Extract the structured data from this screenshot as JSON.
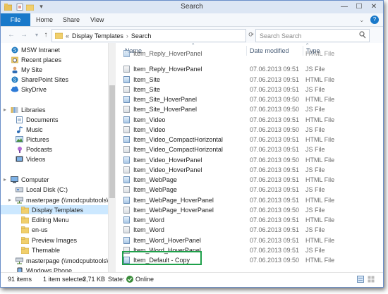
{
  "window": {
    "title": "Search"
  },
  "ribbon": {
    "tabs": [
      "File",
      "Home",
      "Share",
      "View"
    ]
  },
  "address": {
    "prefix": "«",
    "crumbs": [
      "Display Templates",
      "Search"
    ],
    "search_placeholder": "Search Search"
  },
  "nav": [
    {
      "label": "MSW Intranet",
      "icon": "sharepoint-icon"
    },
    {
      "label": "Recent places",
      "icon": "recent-icon"
    },
    {
      "label": "My Site",
      "icon": "user-icon"
    },
    {
      "label": "SharePoint Sites",
      "icon": "sharepoint-icon"
    },
    {
      "label": "SkyDrive",
      "icon": "cloud-icon"
    },
    {
      "label": "Libraries",
      "icon": "library-icon"
    },
    {
      "label": "Documents",
      "icon": "document-icon"
    },
    {
      "label": "Music",
      "icon": "music-icon"
    },
    {
      "label": "Pictures",
      "icon": "picture-icon"
    },
    {
      "label": "Podcasts",
      "icon": "podcast-icon"
    },
    {
      "label": "Videos",
      "icon": "video-icon"
    },
    {
      "label": "Computer",
      "icon": "computer-icon"
    },
    {
      "label": "Local Disk (C:)",
      "icon": "drive-icon"
    },
    {
      "label": "masterpage (\\\\modcpubtools\\D",
      "icon": "network-drive-icon"
    },
    {
      "label": "Display Templates",
      "icon": "folder-icon",
      "selected": true
    },
    {
      "label": "Editing Menu",
      "icon": "folder-icon"
    },
    {
      "label": "en-us",
      "icon": "folder-icon"
    },
    {
      "label": "Preview Images",
      "icon": "folder-icon"
    },
    {
      "label": "Themable",
      "icon": "folder-icon"
    },
    {
      "label": "masterpage (\\\\modcpubtools\\D",
      "icon": "network-drive-icon"
    },
    {
      "label": "Windows Phone",
      "icon": "phone-icon"
    }
  ],
  "columns": {
    "name": "Name",
    "date": "Date modified",
    "type": "Type"
  },
  "files": [
    {
      "name": "Item_Reply_HoverPanel",
      "date": "",
      "type": "HTML File"
    },
    {
      "name": "Item_Reply_HoverPanel",
      "date": "07.06.2013 09:51",
      "type": "JS File"
    },
    {
      "name": "Item_Site",
      "date": "07.06.2013 09:51",
      "type": "HTML File"
    },
    {
      "name": "Item_Site",
      "date": "07.06.2013 09:51",
      "type": "JS File"
    },
    {
      "name": "Item_Site_HoverPanel",
      "date": "07.06.2013 09:50",
      "type": "HTML File"
    },
    {
      "name": "Item_Site_HoverPanel",
      "date": "07.06.2013 09:50",
      "type": "JS File"
    },
    {
      "name": "Item_Video",
      "date": "07.06.2013 09:51",
      "type": "HTML File"
    },
    {
      "name": "Item_Video",
      "date": "07.06.2013 09:50",
      "type": "JS File"
    },
    {
      "name": "Item_Video_CompactHorizontal",
      "date": "07.06.2013 09:51",
      "type": "HTML File"
    },
    {
      "name": "Item_Video_CompactHorizontal",
      "date": "07.06.2013 09:51",
      "type": "JS File"
    },
    {
      "name": "Item_Video_HoverPanel",
      "date": "07.06.2013 09:50",
      "type": "HTML File"
    },
    {
      "name": "Item_Video_HoverPanel",
      "date": "07.06.2013 09:51",
      "type": "JS File"
    },
    {
      "name": "Item_WebPage",
      "date": "07.06.2013 09:51",
      "type": "HTML File"
    },
    {
      "name": "Item_WebPage",
      "date": "07.06.2013 09:51",
      "type": "JS File"
    },
    {
      "name": "Item_WebPage_HoverPanel",
      "date": "07.06.2013 09:51",
      "type": "HTML File"
    },
    {
      "name": "Item_WebPage_HoverPanel",
      "date": "07.06.2013 09:50",
      "type": "JS File"
    },
    {
      "name": "Item_Word",
      "date": "07.06.2013 09:51",
      "type": "HTML File"
    },
    {
      "name": "Item_Word",
      "date": "07.06.2013 09:51",
      "type": "JS File"
    },
    {
      "name": "Item_Word_HoverPanel",
      "date": "07.06.2013 09:51",
      "type": "HTML File"
    },
    {
      "name": "Item_Word_HoverPanel",
      "date": "07.06.2013 09:51",
      "type": "JS File"
    },
    {
      "name": "Item_Default - Copy",
      "date": "07.06.2013 09:50",
      "type": "HTML File",
      "highlight": true
    }
  ],
  "status": {
    "items": "91 items",
    "selected": "1 item selected",
    "size": "2,71 KB",
    "state_label": "State:",
    "state_value": "Online"
  },
  "colors": {
    "accent": "#1979ca",
    "highlight": "#1ea04a",
    "selection": "#cce8ff"
  }
}
